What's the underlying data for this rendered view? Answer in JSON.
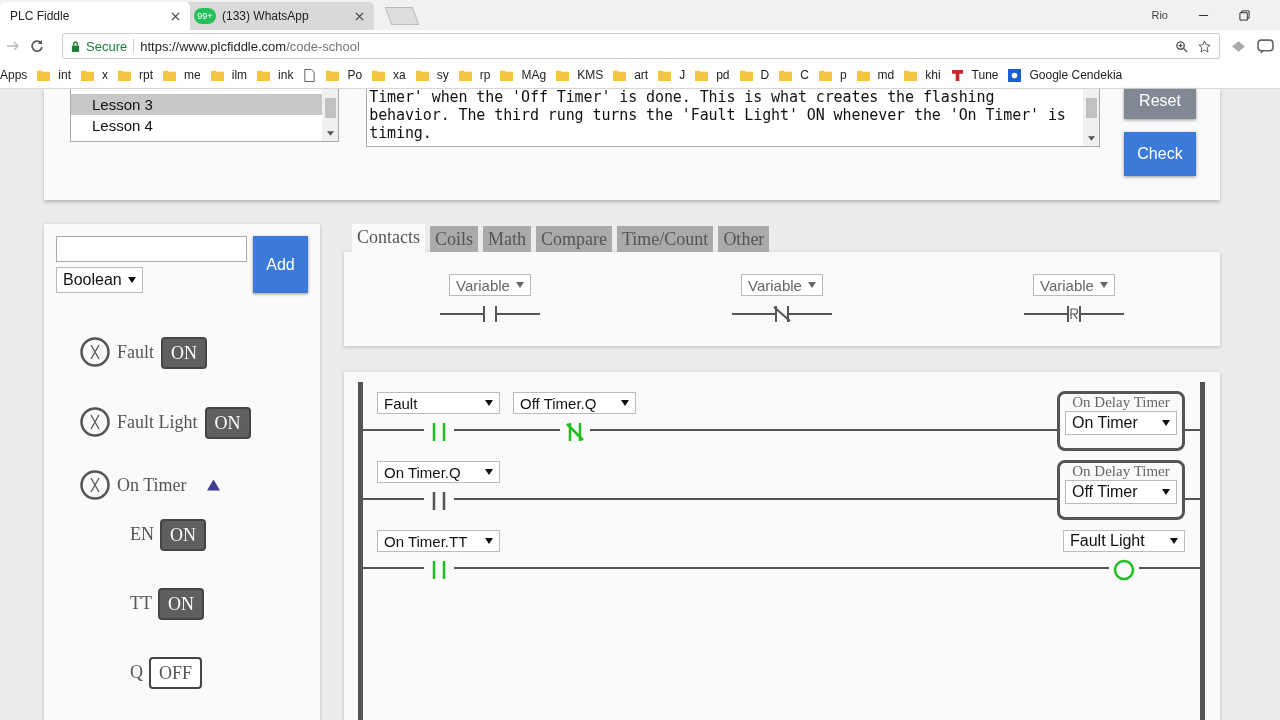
{
  "browser": {
    "tabs": [
      {
        "title": "PLC Fiddle",
        "selected": true
      },
      {
        "title": "(133) WhatsApp",
        "selected": false,
        "badge": "99+"
      }
    ],
    "profile": "Rio",
    "secure_label": "Secure",
    "url_host": "https://www.plcfiddle.com",
    "url_path": "/code-school",
    "bookmarks": [
      {
        "label": "Apps",
        "kind": "apps"
      },
      {
        "label": "int",
        "kind": "folder"
      },
      {
        "label": "x",
        "kind": "folder"
      },
      {
        "label": "rpt",
        "kind": "folder"
      },
      {
        "label": "me",
        "kind": "folder"
      },
      {
        "label": "ilm",
        "kind": "folder"
      },
      {
        "label": "ink",
        "kind": "folder"
      },
      {
        "kind": "page"
      },
      {
        "label": "Po",
        "kind": "folder"
      },
      {
        "label": "xa",
        "kind": "folder"
      },
      {
        "label": "sy",
        "kind": "folder"
      },
      {
        "label": "rp",
        "kind": "folder"
      },
      {
        "label": "MAg",
        "kind": "folder"
      },
      {
        "label": "KMS",
        "kind": "folder"
      },
      {
        "label": "art",
        "kind": "folder"
      },
      {
        "label": "J",
        "kind": "folder"
      },
      {
        "label": "pd",
        "kind": "folder"
      },
      {
        "label": "D",
        "kind": "folder"
      },
      {
        "label": "C",
        "kind": "folder"
      },
      {
        "label": "p",
        "kind": "folder"
      },
      {
        "label": "md",
        "kind": "folder"
      },
      {
        "label": "khi",
        "kind": "folder"
      },
      {
        "label": "Tune",
        "kind": "red-app"
      },
      {
        "label": "Google Cendekia",
        "kind": "blue-app"
      }
    ]
  },
  "lessons": [
    {
      "label": "Lesson 3",
      "selected": true
    },
    {
      "label": "Lesson 4",
      "selected": false
    }
  ],
  "description": "Timer' when the 'Off Timer' is done. This is what creates the flashing behavior. The third rung turns the 'Fault Light' ON whenever the 'On Timer' is timing.",
  "lesson_buttons": [
    {
      "label": "Reset",
      "kind": "reset"
    },
    {
      "label": "Check",
      "kind": "check"
    }
  ],
  "new_variable": {
    "type": "Boolean",
    "add_label": "Add"
  },
  "variables": [
    {
      "name": "Fault",
      "kind": "bool",
      "value": "ON",
      "on": true
    },
    {
      "name": "Fault Light",
      "kind": "bool",
      "value": "ON",
      "on": true
    },
    {
      "name": "On Timer",
      "kind": "timer",
      "expanded": true,
      "members": [
        {
          "name": "EN",
          "value": "ON",
          "on": true
        },
        {
          "name": "TT",
          "value": "ON",
          "on": true
        },
        {
          "name": "Q",
          "value": "OFF",
          "on": false
        }
      ]
    }
  ],
  "tabs": [
    {
      "label": "Contacts",
      "selected": true
    },
    {
      "label": "Coils",
      "selected": false
    },
    {
      "label": "Math",
      "selected": false
    },
    {
      "label": "Compare",
      "selected": false
    },
    {
      "label": "Time/Count",
      "selected": false
    },
    {
      "label": "Other",
      "selected": false
    }
  ],
  "palette": [
    {
      "kind": "no",
      "variable": "Variable"
    },
    {
      "kind": "nc",
      "variable": "Variable"
    },
    {
      "kind": "reset",
      "variable": "Variable"
    }
  ],
  "rungs": [
    {
      "elements": [
        {
          "kind": "no",
          "variable": "Fault",
          "energized": true
        },
        {
          "kind": "nc",
          "variable": "Off Timer.Q",
          "energized": true
        }
      ],
      "output": {
        "kind": "timer",
        "title": "On Delay Timer",
        "variable": "On Timer",
        "energized": false
      }
    },
    {
      "elements": [
        {
          "kind": "no",
          "variable": "On Timer.Q",
          "energized": false
        }
      ],
      "output": {
        "kind": "timer",
        "title": "On Delay Timer",
        "variable": "Off Timer",
        "energized": false
      }
    },
    {
      "elements": [
        {
          "kind": "no",
          "variable": "On Timer.TT",
          "energized": true
        }
      ],
      "output": {
        "kind": "coil",
        "variable": "Fault Light",
        "energized": true
      }
    }
  ]
}
